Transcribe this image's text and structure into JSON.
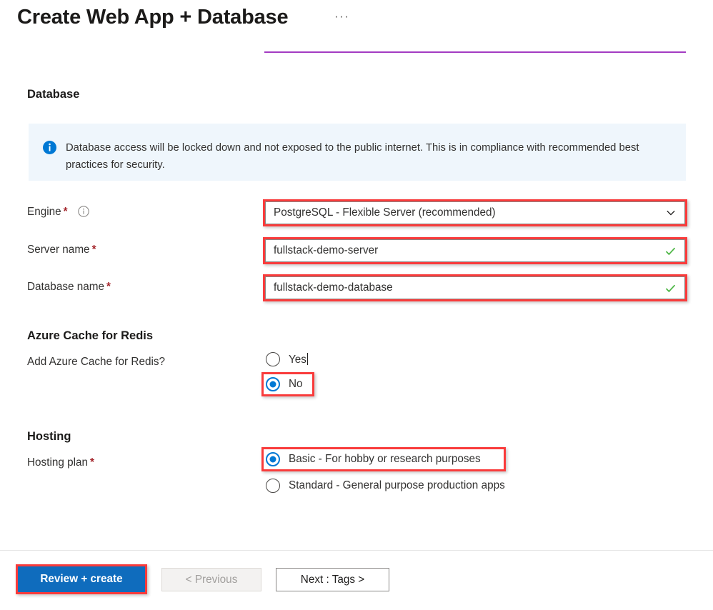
{
  "header": {
    "title": "Create Web App + Database",
    "ellipsis": "···"
  },
  "sections": {
    "database": {
      "heading": "Database",
      "banner": {
        "icon": "info-icon",
        "text": "Database access will be locked down and not exposed to the public internet. This is in compliance with recommended best practices for security.",
        "background": "#eff6fc",
        "icon_color": "#0078d4"
      },
      "fields": [
        {
          "label": "Engine",
          "required": "*",
          "has_info_icon": true,
          "type": "dropdown",
          "value": "PostgreSQL - Flexible Server (recommended)",
          "trailing_icon": "chevron-down-icon",
          "highlighted": true
        },
        {
          "label": "Server name",
          "required": "*",
          "has_info_icon": false,
          "type": "text",
          "value": "fullstack-demo-server",
          "trailing_icon": "check-icon",
          "highlighted": true
        },
        {
          "label": "Database name",
          "required": "*",
          "has_info_icon": false,
          "type": "text",
          "value": "fullstack-demo-database",
          "trailing_icon": "check-icon",
          "highlighted": true
        }
      ]
    },
    "redis": {
      "heading": "Azure Cache for Redis",
      "question_label": "Add Azure Cache for Redis?",
      "options": [
        {
          "label": "Yes",
          "selected": false,
          "highlighted": false
        },
        {
          "label": "No",
          "selected": true,
          "highlighted": true
        }
      ]
    },
    "hosting": {
      "heading": "Hosting",
      "plan_label": "Hosting plan",
      "plan_required": "*",
      "options": [
        {
          "label": "Basic - For hobby or research purposes",
          "selected": true,
          "highlighted": true
        },
        {
          "label": "Standard - General purpose production apps",
          "selected": false,
          "highlighted": false
        }
      ]
    }
  },
  "footer": {
    "review_create": "Review + create",
    "previous": "< Previous",
    "next": "Next : Tags >"
  },
  "colors": {
    "accent": "#0078d4",
    "primary_button": "#0f6cbd",
    "highlight": "#f93b3b",
    "required": "#a4262c",
    "valid_check": "#4bb543",
    "cutoff_field_border": "#a33bc2"
  }
}
